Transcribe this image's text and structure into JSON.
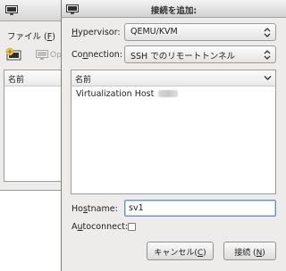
{
  "background_window": {
    "menu_file_prefix": "ファイル (",
    "menu_file_mnemonic": "F",
    "menu_file_suffix": ")",
    "open_label": "Op",
    "list_header": "名前"
  },
  "dialog": {
    "title": "接続を追加:",
    "hypervisor": {
      "label_mnemonic": "H",
      "label_rest": "ypervisor:",
      "value": "QEMU/KVM"
    },
    "connection": {
      "label_prefix": "Co",
      "label_mnemonic": "n",
      "label_rest": "nection:",
      "value": "SSH でのリモートトンネル"
    },
    "host_list": {
      "header": "名前",
      "items": [
        {
          "label": "Virtualization Host"
        }
      ]
    },
    "hostname": {
      "label_prefix": "Ho",
      "label_mnemonic": "s",
      "label_rest": "tname:",
      "value": "sv1"
    },
    "autoconnect": {
      "label_prefix": "A",
      "label_mnemonic": "u",
      "label_rest": "toconnect:",
      "checked": false
    },
    "buttons": {
      "cancel_prefix": "キャンセル(",
      "cancel_mnemonic": "C",
      "cancel_suffix": ")",
      "connect_prefix": "接続 (",
      "connect_mnemonic": "N",
      "connect_suffix": ")"
    }
  },
  "icons": {
    "window_icon": "monitor-icon",
    "new_connection_icon": "new-connection-icon",
    "open_icon": "monitor-icon",
    "combo_arrows": "updown-arrows-icon",
    "list_chevron": "chevron-down-icon"
  }
}
